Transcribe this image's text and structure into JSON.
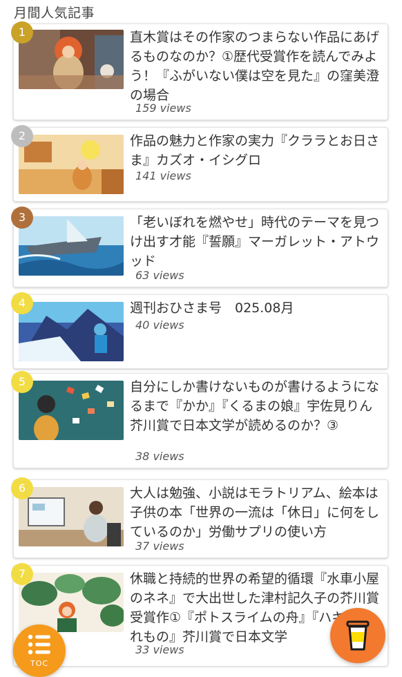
{
  "section": {
    "title": "月間人気記事"
  },
  "articles": [
    {
      "rank": "1",
      "rank_color": "#c9a227",
      "title": "直木賞はその作家のつまらない作品にあげるものなのか？①歴代受賞作を読んでみよう！『ふがいない僕は空を見た』の窪美澄の場合",
      "views": "159 views"
    },
    {
      "rank": "2",
      "rank_color": "#bdbdbd",
      "title": "作品の魅力と作家の実力『クララとお日さま』カズオ・イシグロ",
      "views": "141 views"
    },
    {
      "rank": "3",
      "rank_color": "#b0703c",
      "title": "「老いぼれを燃やせ」時代のテーマを見つけ出す才能『誓願』マーガレット・アトウッド",
      "views": "63 views"
    },
    {
      "rank": "4",
      "rank_color": "#f2dc43",
      "title": "週刊おひさま号　025.08月",
      "views": "40 views"
    },
    {
      "rank": "5",
      "rank_color": "#f2dc43",
      "title": "自分にしか書けないものが書けるようになるまで『かか』『くるまの娘』宇佐見りん　芥川賞で日本文学が読めるのか？③",
      "views": "38 views"
    },
    {
      "rank": "6",
      "rank_color": "#f2dc43",
      "title": "大人は勉強、小説はモラトリアム、絵本は子供の本「世界の一流は「休日」に何をしているのか」労働サプリの使い方",
      "views": "37 views"
    },
    {
      "rank": "7",
      "rank_color": "#f2dc43",
      "title": "休職と持続的世界の希望的循環『水車小屋のネネ』で大出世した津村記久子の芥川賞受賞作①『ポトスライムの舟』『ハキの忘れもの』芥川賞で日本文学",
      "views": "33 views"
    }
  ],
  "toc_button": {
    "label": "TOC",
    "icon": "list-icon"
  },
  "coffee_button": {
    "icon": "coffee-cup-icon"
  }
}
